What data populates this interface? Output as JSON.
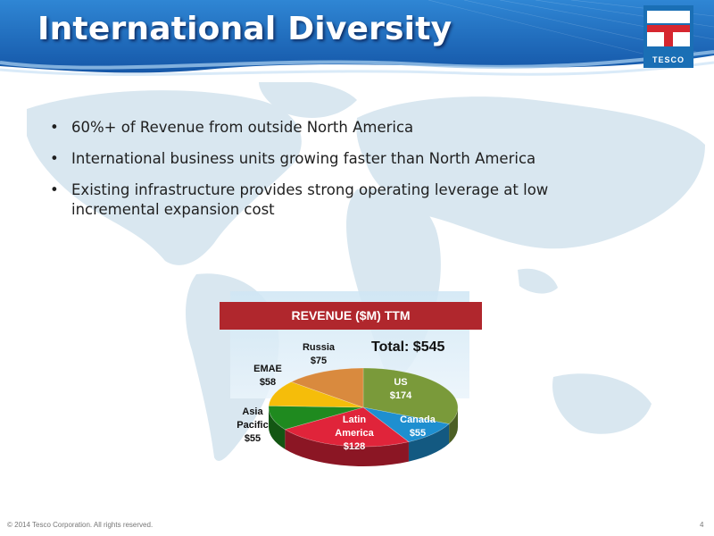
{
  "header": {
    "title": "International Diversity"
  },
  "logo": {
    "text": "TESCO"
  },
  "bullets": [
    {
      "bullet": "•",
      "text": "60%+ of Revenue from outside North America"
    },
    {
      "bullet": "•",
      "text": "International business units growing faster than North America"
    },
    {
      "bullet": "•",
      "text": "Existing infrastructure provides strong operating leverage at low incremental expansion cost"
    }
  ],
  "chart_data": {
    "type": "pie",
    "title": "REVENUE ($M) TTM",
    "total_label": "Total: $545",
    "slices": [
      {
        "name": "US",
        "value_label": "$174",
        "value": 174,
        "color": "#7a9a3a"
      },
      {
        "name": "Canada",
        "value_label": "$55",
        "value": 55,
        "color": "#1e8fd0"
      },
      {
        "name": "Latin America",
        "value_label": "$128",
        "value": 128,
        "color": "#e0243a"
      },
      {
        "name": "Asia Pacific",
        "value_label": "$55",
        "value": 55,
        "color": "#1f8a1f"
      },
      {
        "name": "EMAE",
        "value_label": "$58",
        "value": 58,
        "color": "#f5bd0a"
      },
      {
        "name": "Russia",
        "value_label": "$75",
        "value": 75,
        "color": "#d98a3e"
      }
    ]
  },
  "footer": {
    "copyright": "© 2014 Tesco Corporation. All rights reserved.",
    "page": "4"
  }
}
